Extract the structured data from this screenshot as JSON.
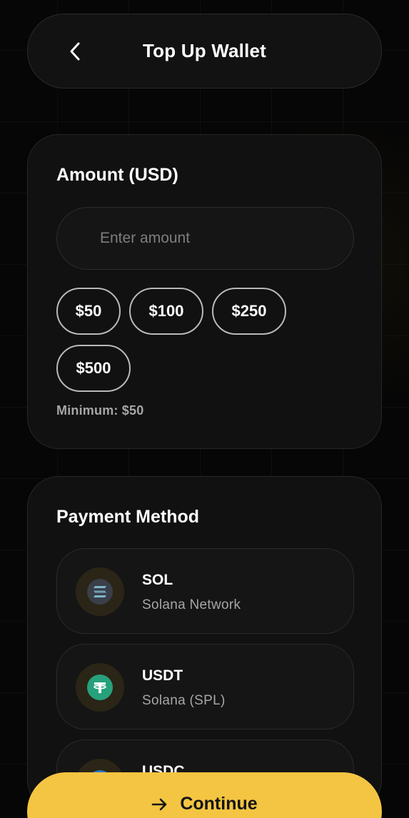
{
  "header": {
    "title": "Top Up Wallet",
    "back_icon": "chevron-left-icon"
  },
  "amount_card": {
    "title": "Amount (USD)",
    "input": {
      "value": "",
      "placeholder": "Enter amount"
    },
    "presets": [
      "$50",
      "$100",
      "$250",
      "$500"
    ],
    "minimum_hint": "Minimum: $50"
  },
  "payment_card": {
    "title": "Payment Method",
    "methods": [
      {
        "name": "SOL",
        "network": "Solana Network",
        "icon": "solana-icon"
      },
      {
        "name": "USDT",
        "network": "Solana (SPL)",
        "icon": "tether-icon"
      },
      {
        "name": "USDC",
        "network": "",
        "icon": "usdc-icon"
      }
    ]
  },
  "continue_button": {
    "label": "Continue",
    "icon": "arrow-right-icon"
  },
  "colors": {
    "background": "#060606",
    "card": "#111111",
    "accent": "#f4c542",
    "muted_text": "#a6a6a6",
    "tether_green": "#26a17b",
    "usdc_blue": "#2775ca"
  }
}
